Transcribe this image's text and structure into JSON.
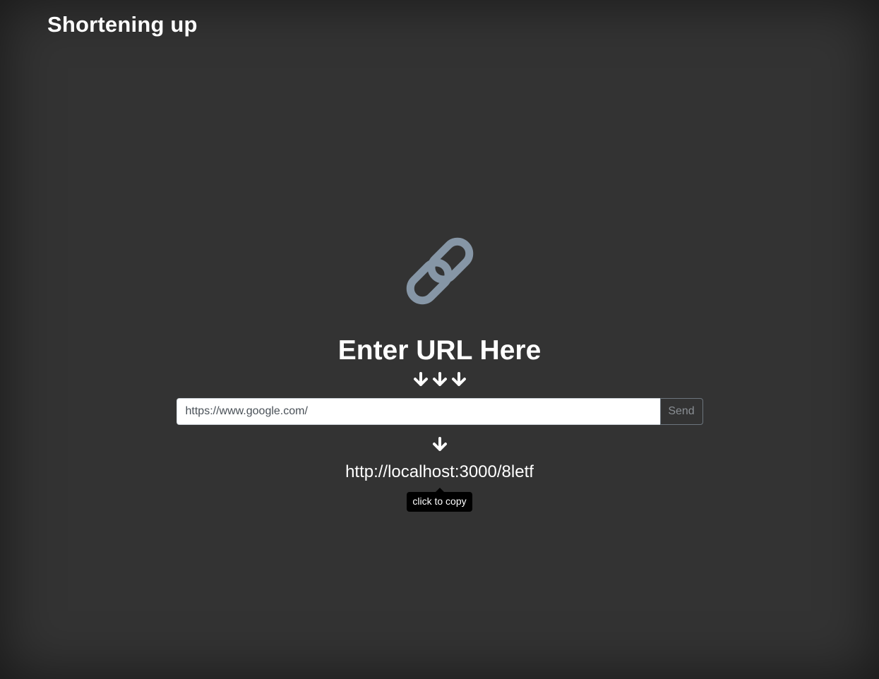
{
  "header": {
    "brand": "Shortening up"
  },
  "main": {
    "icon": "link-icon",
    "icon_color": "#8696a6",
    "title": "Enter URL Here",
    "arrows_icon": "arrow-down-icon",
    "input": {
      "value": "https://www.google.com/"
    },
    "send_label": "Send",
    "result_arrow_icon": "arrow-down-icon",
    "short_url": "http://localhost:3000/8letf",
    "tooltip": "click to copy"
  },
  "colors": {
    "background": "#333333",
    "text": "#ffffff",
    "tooltip_bg": "#000000"
  }
}
